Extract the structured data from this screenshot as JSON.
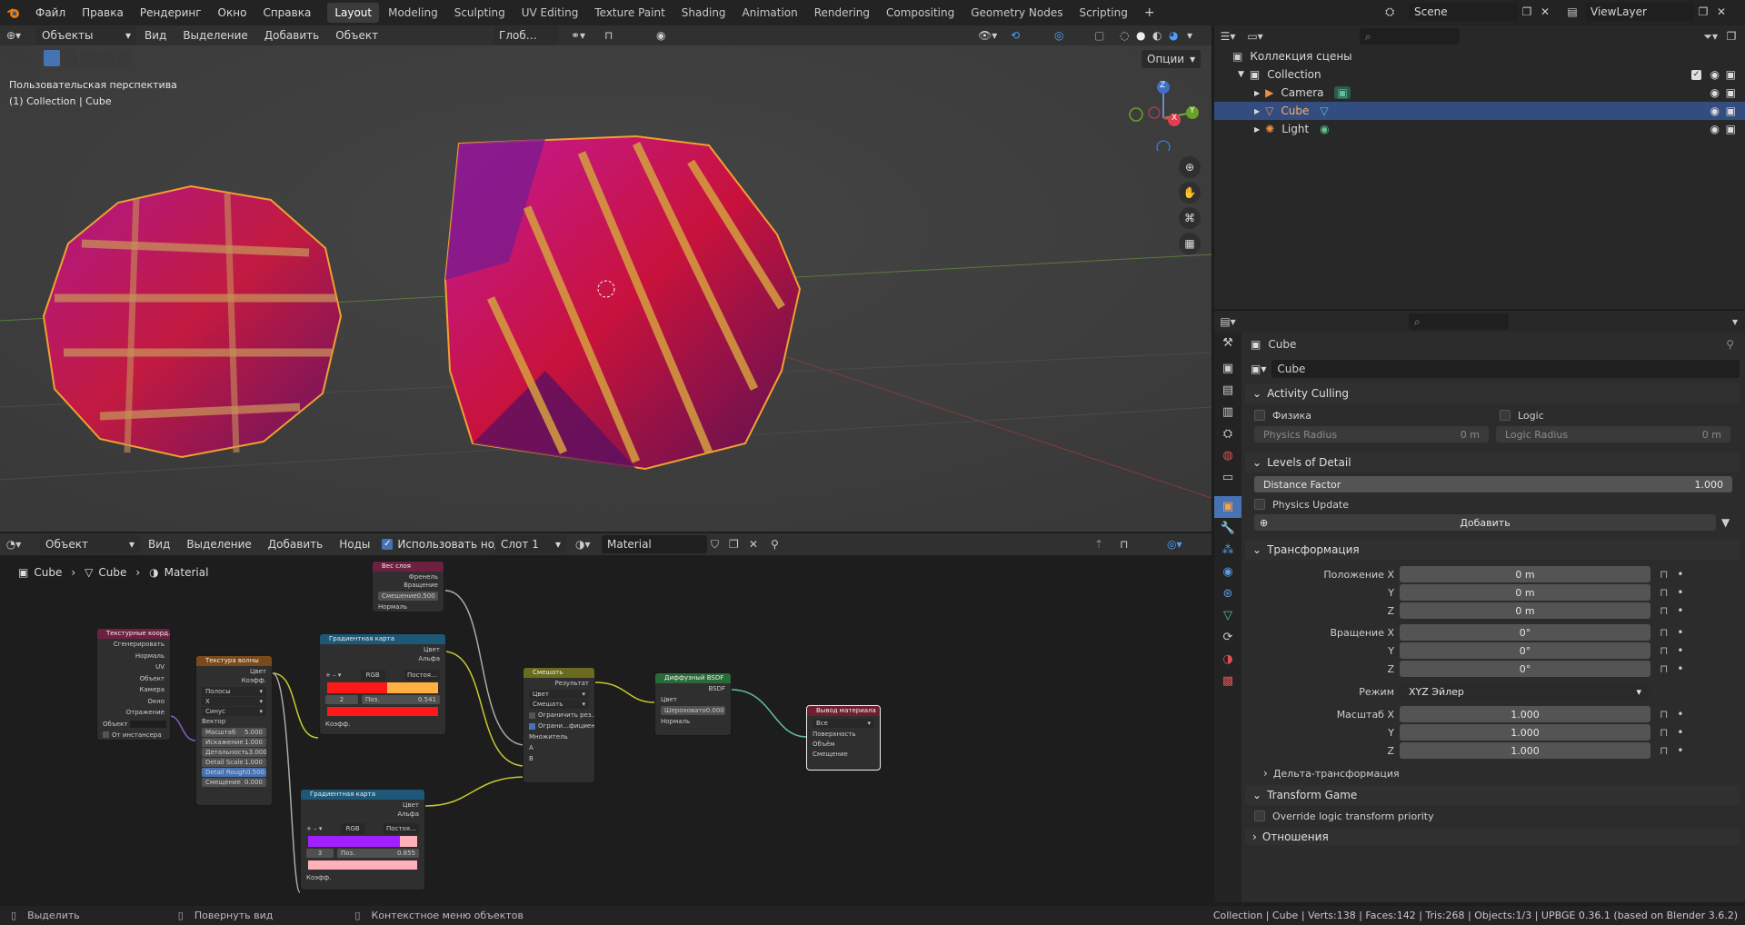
{
  "topbar": {
    "menus": [
      "Файл",
      "Правка",
      "Рендеринг",
      "Окно",
      "Справка"
    ],
    "workspaces": [
      "Layout",
      "Modeling",
      "Sculpting",
      "UV Editing",
      "Texture Paint",
      "Shading",
      "Animation",
      "Rendering",
      "Compositing",
      "Geometry Nodes",
      "Scripting"
    ],
    "active_workspace": "Layout",
    "add_tab": "+",
    "scene": "Scene",
    "view_layer": "ViewLayer"
  },
  "viewport": {
    "mode": "Объекты",
    "menus": [
      "Вид",
      "Выделение",
      "Добавить",
      "Объект"
    ],
    "orientation": "Глоб…",
    "options": "Опции",
    "perspective_label": "Пользовательская перспектива",
    "collection_label": "(1) Collection | Cube",
    "gizmo": {
      "z": "Z",
      "x": "X",
      "y": "Y"
    }
  },
  "node_editor": {
    "mode": "Объект",
    "menus": [
      "Вид",
      "Выделение",
      "Добавить",
      "Ноды"
    ],
    "use_nodes_label": "Использовать ноды",
    "slot": "Слот 1",
    "material": "Material",
    "breadcrumb": [
      "Cube",
      "Cube",
      "Material"
    ],
    "nodes": {
      "layer_weight": {
        "title": "Вес слоя",
        "out1": "Френель",
        "out2": "Вращение",
        "blend_label": "Смешение",
        "blend_value": "0.500",
        "normal": "Нормаль"
      },
      "tex_coord": {
        "title": "Текстурные коорд…",
        "outs": [
          "Сгенерировать",
          "Нормаль",
          "UV",
          "Объект",
          "Камера",
          "Окно",
          "Отражение"
        ],
        "object_label": "Объект",
        "instancer": "От инстансера"
      },
      "wave": {
        "title": "Текстура волны",
        "out1": "Цвет",
        "out2": "Коэфф.",
        "type": "Полосы",
        "dir": "X",
        "profile": "Синус",
        "vector": "Вектор",
        "fields": [
          [
            "Масштаб",
            "5.000"
          ],
          [
            "Искажение",
            "1.000"
          ],
          [
            "Детальность",
            "3.000"
          ],
          [
            "Detail Scale",
            "1.000"
          ],
          [
            "Detail Rough",
            "0.500"
          ],
          [
            "Смещение",
            "0.000"
          ]
        ]
      },
      "ramp1": {
        "title": "Градиентная карта",
        "out1": "Цвет",
        "out2": "Альфа",
        "mode": "RGB",
        "interp": "Постоя…",
        "index": "2",
        "pos_label": "Поз.",
        "pos_value": "0.541",
        "fac": "Коэфф."
      },
      "ramp2": {
        "title": "Градиентная карта",
        "out1": "Цвет",
        "out2": "Альфа",
        "mode": "RGB",
        "interp": "Постоя…",
        "index": "3",
        "pos_label": "Поз.",
        "pos_value": "0.855",
        "fac": "Коэфф."
      },
      "mix": {
        "title": "Смешать",
        "out": "Результат",
        "type": "Цвет",
        "blend": "Смешать",
        "clamp_result": "Ограничить рез…",
        "clamp_factor": "Ограни…фициент",
        "factor": "Множитель",
        "a": "A",
        "b": "B"
      },
      "diffuse": {
        "title": "Диффузный BSDF",
        "out": "BSDF",
        "color": "Цвет",
        "rough_label": "Шероховато",
        "rough_value": "0.000",
        "normal": "Нормаль"
      },
      "output": {
        "title": "Вывод материала",
        "target": "Все",
        "ins": [
          "Поверхность",
          "Объём",
          "Смещение"
        ]
      }
    }
  },
  "outliner": {
    "root": "Коллекция сцены",
    "collection": "Collection",
    "items": [
      "Camera",
      "Cube",
      "Light"
    ],
    "selected": "Cube"
  },
  "properties": {
    "object_name": "Cube",
    "object_field": "Cube",
    "activity_culling": "Activity Culling",
    "physics": "Физика",
    "logic": "Logic",
    "physics_radius_label": "Physics Radius",
    "physics_radius_value": "0 m",
    "logic_radius_label": "Logic Radius",
    "logic_radius_value": "0 m",
    "lod": "Levels of Detail",
    "distance_factor_label": "Distance Factor",
    "distance_factor_value": "1.000",
    "physics_update": "Physics Update",
    "add_button": "Добавить",
    "transform": "Трансформация",
    "location_label": "Положение X",
    "loc": [
      "0 m",
      "0 m",
      "0 m"
    ],
    "rotation_label": "Вращение X",
    "rot": [
      "0°",
      "0°",
      "0°"
    ],
    "mode_label": "Режим",
    "mode_value": "XYZ Эйлер",
    "scale_label": "Масштаб X",
    "scale": [
      "1.000",
      "1.000",
      "1.000"
    ],
    "axis_y": "Y",
    "axis_z": "Z",
    "delta": "Дельта-трансформация",
    "transform_game": "Transform Game",
    "override": "Override logic transform priority",
    "relations": "Отношения"
  },
  "status": {
    "select": "Выделить",
    "rotate": "Повернуть вид",
    "context": "Контекстное меню объектов",
    "info": "Collection | Cube | Verts:138 | Faces:142 | Tris:268 | Objects:1/3 | UPBGE 0.36.1 (based on Blender 3.6.2)"
  },
  "colors": {
    "accent": "#4772b3",
    "selected_row": "#334d80",
    "orange": "#e8a040"
  }
}
